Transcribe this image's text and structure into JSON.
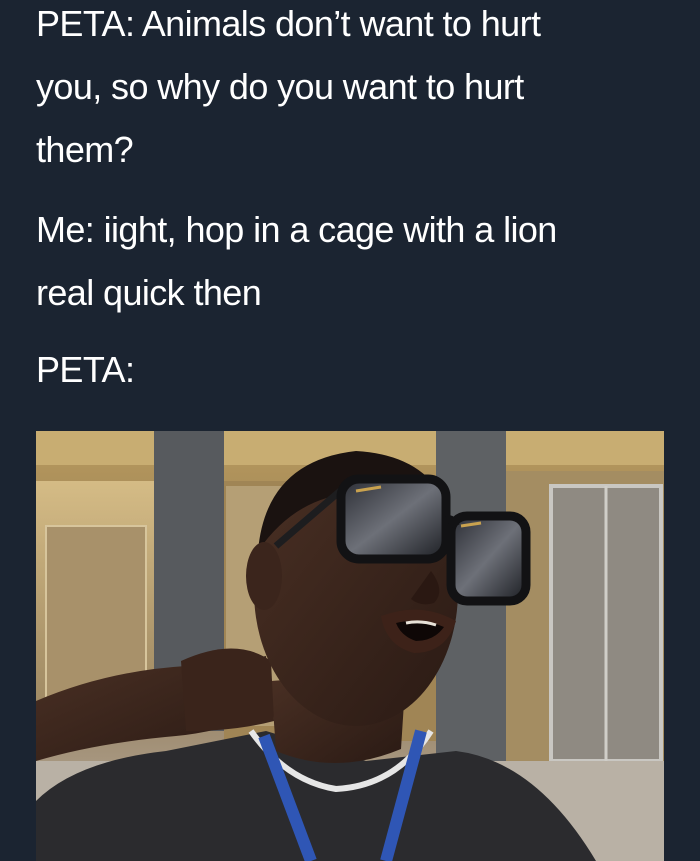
{
  "post": {
    "lines": {
      "p1_l1": "PETA: Animals don’t want to hurt",
      "p1_l2": "you, so why do you want to hurt",
      "p1_l3": "them?",
      "p2_l1": "Me: iight, hop in a cage with a lion",
      "p2_l2": "real quick then",
      "p3_l1": "PETA:"
    }
  },
  "colors": {
    "background": "#1b2431",
    "text": "#ffffff"
  },
  "photo": {
    "subject": "man-in-large-sunglasses-reaction-photo"
  }
}
